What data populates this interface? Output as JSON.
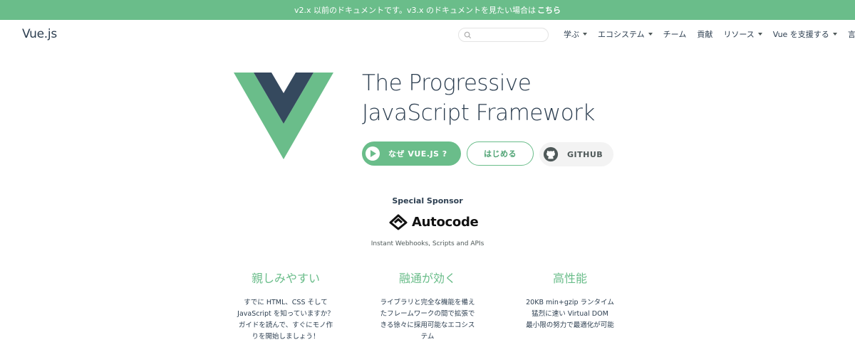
{
  "banner": {
    "text": "v2.x 以前のドキュメントです。v3.x のドキュメントを見たい場合は",
    "link": "こちら"
  },
  "header": {
    "brand": "Vue.js",
    "search_placeholder": "",
    "nav": [
      {
        "label": "学ぶ",
        "dropdown": true
      },
      {
        "label": "エコシステム",
        "dropdown": true
      },
      {
        "label": "チーム",
        "dropdown": false
      },
      {
        "label": "貢献",
        "dropdown": false
      },
      {
        "label": "リソース",
        "dropdown": true
      },
      {
        "label": "Vue を支援する",
        "dropdown": true
      },
      {
        "label": "言語",
        "dropdown": true
      }
    ]
  },
  "hero": {
    "tagline_line1": "The Progressive",
    "tagline_line2": "JavaScript Framework",
    "buttons": {
      "why": "なぜ VUE.JS ?",
      "start": "はじめる",
      "github": "GITHUB"
    }
  },
  "sponsor": {
    "label": "Special Sponsor",
    "name": "Autocode",
    "description": "Instant Webhooks, Scripts and APIs"
  },
  "features": [
    {
      "title": "親しみやすい",
      "body": [
        "すでに HTML、CSS そして",
        "JavaScript を知っていますか？",
        "ガイドを読んで、すぐにモノ作",
        "りを開始しましょう！"
      ]
    },
    {
      "title": "融通が効く",
      "body": [
        "ライブラリと完全な機能を備え",
        "たフレームワークの間で拡張で",
        "きる徐々に採用可能なエコシス",
        "テム"
      ]
    },
    {
      "title": "高性能",
      "body": [
        "20KB min+gzip ランタイム",
        "猛烈に速い Virtual DOM",
        "最小限の努力で最適化が可能"
      ]
    }
  ],
  "colors": {
    "brand_green": "#6abd8a",
    "brand_dark": "#35495e"
  }
}
